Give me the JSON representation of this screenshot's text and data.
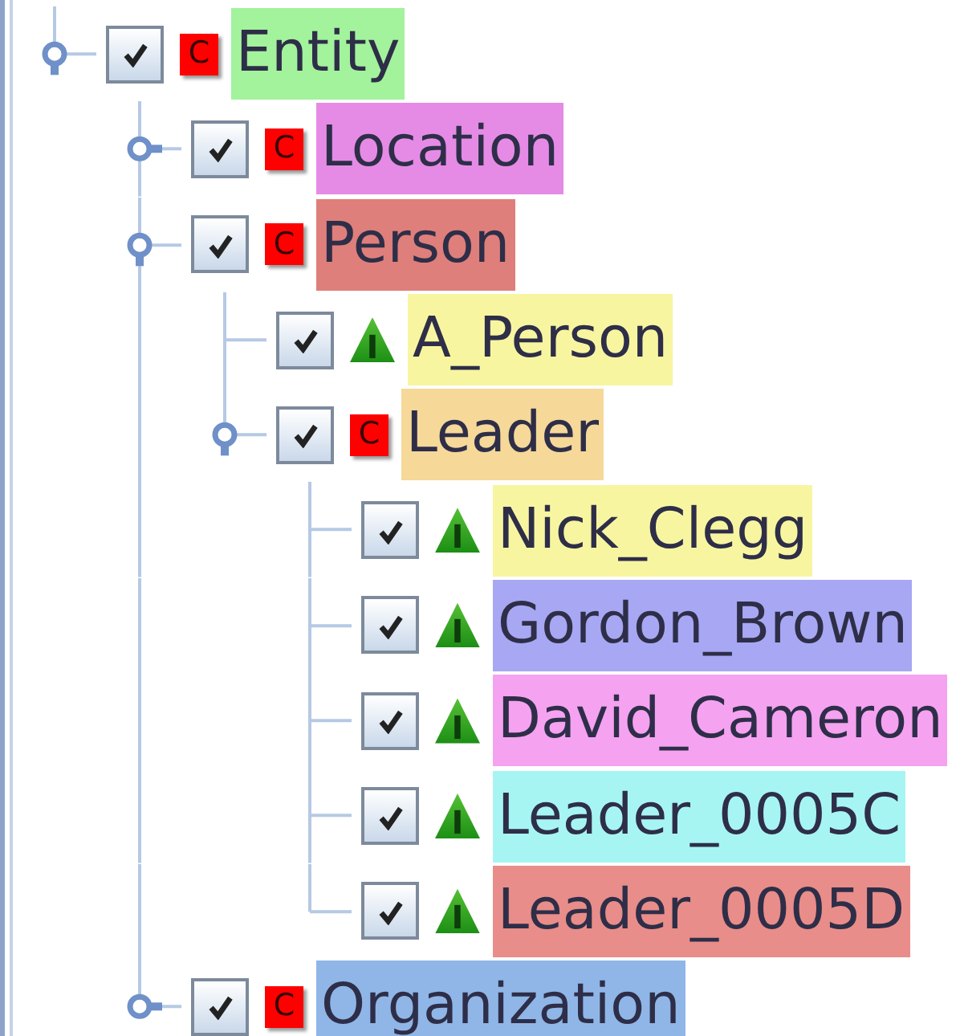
{
  "tree": {
    "nodes": [
      {
        "label": "Entity",
        "kind": "class",
        "badge": "C",
        "checked": true,
        "expanded": true,
        "color": "#a3f29c",
        "children": [
          {
            "label": "Location",
            "kind": "class",
            "badge": "C",
            "checked": true,
            "expanded": false,
            "color": "#e58be6"
          },
          {
            "label": "Person",
            "kind": "class",
            "badge": "C",
            "checked": true,
            "expanded": true,
            "color": "#de7f7b",
            "children": [
              {
                "label": "A_Person",
                "kind": "instance",
                "badge": "I",
                "checked": true,
                "color": "#f8f5a1"
              },
              {
                "label": "Leader",
                "kind": "class",
                "badge": "C",
                "checked": true,
                "expanded": true,
                "color": "#f6d899",
                "children": [
                  {
                    "label": "Nick_Clegg",
                    "kind": "instance",
                    "badge": "I",
                    "checked": true,
                    "color": "#f8f5a1"
                  },
                  {
                    "label": "Gordon_Brown",
                    "kind": "instance",
                    "badge": "I",
                    "checked": true,
                    "color": "#a7a7f3"
                  },
                  {
                    "label": "David_Cameron",
                    "kind": "instance",
                    "badge": "I",
                    "checked": true,
                    "color": "#f5a2f1"
                  },
                  {
                    "label": "Leader_0005C",
                    "kind": "instance",
                    "badge": "I",
                    "checked": true,
                    "color": "#a7f5f3"
                  },
                  {
                    "label": "Leader_0005D",
                    "kind": "instance",
                    "badge": "I",
                    "checked": true,
                    "color": "#e88d89"
                  }
                ]
              }
            ]
          },
          {
            "label": "Organization",
            "kind": "class",
            "badge": "C",
            "checked": true,
            "expanded": false,
            "color": "#8fb6e7"
          }
        ]
      }
    ]
  }
}
